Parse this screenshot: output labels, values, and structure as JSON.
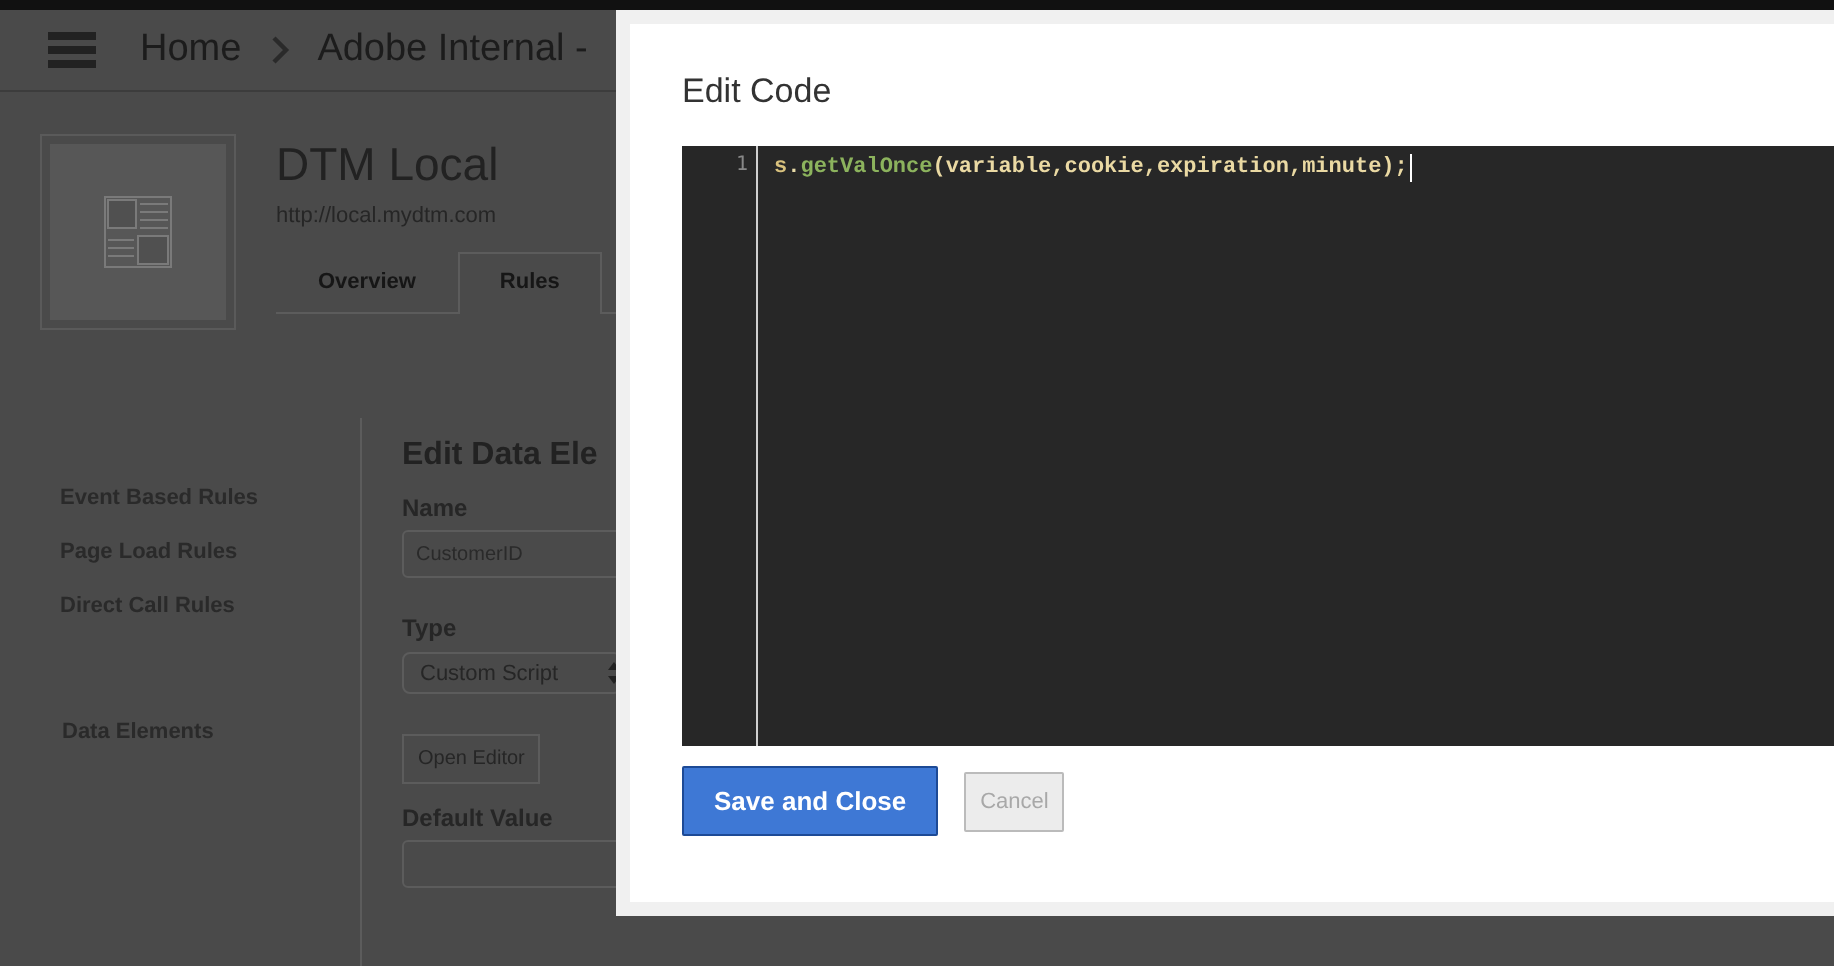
{
  "header": {
    "breadcrumbs": [
      {
        "label": "Home"
      },
      {
        "label": "Adobe Internal -"
      }
    ]
  },
  "property": {
    "title": "DTM Local",
    "url": "http://local.mydtm.com"
  },
  "tabs": [
    {
      "label": "Overview",
      "selected": false
    },
    {
      "label": "Rules",
      "selected": true
    }
  ],
  "sidebar": {
    "groups": [
      [
        {
          "label": "Event Based Rules",
          "selected": false
        },
        {
          "label": "Page Load Rules",
          "selected": false
        },
        {
          "label": "Direct Call Rules",
          "selected": false
        }
      ],
      [
        {
          "label": "Data Elements",
          "selected": true
        }
      ]
    ]
  },
  "form": {
    "title": "Edit Data Ele",
    "name_label": "Name",
    "name_value": "CustomerID",
    "type_label": "Type",
    "type_value": "Custom Script",
    "editor_button": "Open Editor",
    "default_label": "Default Value"
  },
  "modal": {
    "title": "Edit Code",
    "editor": {
      "lines": [
        {
          "number": "1",
          "tokens": [
            {
              "text": "s",
              "kind": "identifier"
            },
            {
              "text": ".",
              "kind": "punctuation"
            },
            {
              "text": "getValOnce",
              "kind": "function"
            },
            {
              "text": "(variable,cookie,expiration,minute);",
              "kind": "argument"
            }
          ]
        }
      ]
    },
    "buttons": [
      {
        "label": "Save and Close",
        "kind": "primary",
        "disabled": false
      },
      {
        "label": "Cancel",
        "kind": "secondary",
        "disabled": true
      }
    ]
  }
}
